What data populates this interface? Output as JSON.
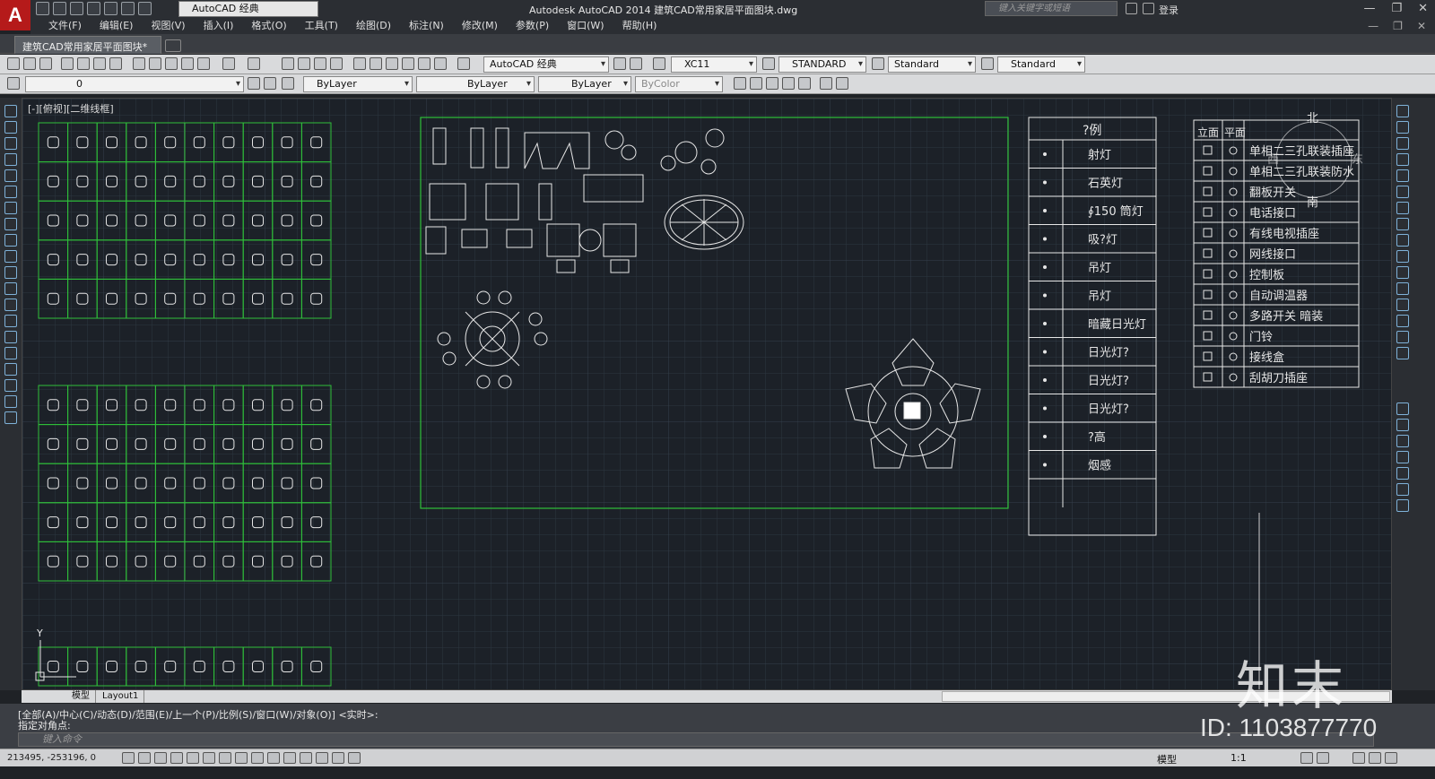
{
  "app": {
    "window_title": "Autodesk AutoCAD 2014    建筑CAD常用家居平面图块.dwg",
    "workspace": "AutoCAD 经典",
    "search_placeholder": "键入关键字或短语",
    "login": "登录"
  },
  "menu": [
    "文件(F)",
    "编辑(E)",
    "视图(V)",
    "插入(I)",
    "格式(O)",
    "工具(T)",
    "绘图(D)",
    "标注(N)",
    "修改(M)",
    "参数(P)",
    "窗口(W)",
    "帮助(H)"
  ],
  "document_tab": "建筑CAD常用家居平面图块*",
  "toolbar": {
    "workspace_combo": "AutoCAD 经典",
    "text_style": "XC11",
    "dim_style": "STANDARD",
    "table_style": "Standard",
    "multileader_style": "Standard",
    "layer": "0",
    "color": "ByLayer",
    "linetype": "ByLayer",
    "lineweight": "ByLayer",
    "plot_style": "ByColor"
  },
  "viewport_label": "[-][俯视][二维线框]",
  "legend": {
    "title": "?例",
    "rows": [
      "射灯",
      "石英灯",
      "∮150 筒灯",
      "吸?灯",
      "吊灯",
      "吊灯",
      "暗藏日光灯",
      "日光灯?",
      "日光灯?",
      "日光灯?",
      "?高",
      "烟感"
    ]
  },
  "socket_legend": {
    "headers": [
      "立面",
      "平面"
    ],
    "rows": [
      "单相二三孔联装插座",
      "单相二三孔联装防水",
      "翻板开关",
      "电话接口",
      "有线电视插座",
      "网线接口",
      "控制板",
      "自动调温器",
      "多路开关    暗装",
      "门铃",
      "接线盒",
      "刮胡刀插座"
    ]
  },
  "compass": {
    "north": "北",
    "south": "南",
    "west": "西",
    "east": "东"
  },
  "ucs": {
    "y": "Y"
  },
  "layout_tabs": [
    "模型",
    "Layout1"
  ],
  "command_line": {
    "history1": "[全部(A)/中心(C)/动态(D)/范围(E)/上一个(P)/比例(S)/窗口(W)/对象(O)] <实时>:",
    "history2": "指定对角点:",
    "input_placeholder": "键入命令"
  },
  "status": {
    "coords": "213495, -253196, 0",
    "model": "模型",
    "scale": "1:1"
  },
  "watermark": {
    "logo": "知末",
    "id": "ID: 1103877770"
  },
  "colors": {
    "grid": "#2d3640",
    "frame_green": "#2fbf3a",
    "line_white": "#e6e6e6",
    "canvas": "#212830"
  }
}
